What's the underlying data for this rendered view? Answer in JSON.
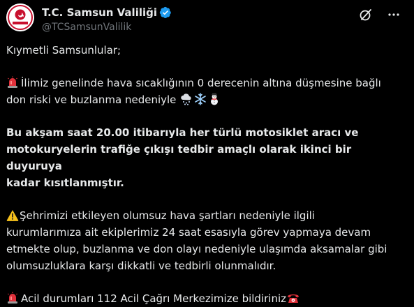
{
  "account": {
    "display_name": "T.C. Samsun Valiliği",
    "handle": "@TCSamsunValilik",
    "verified_color": "#1d9bf0",
    "avatar_icon": "samsun-valilik-seal-icon"
  },
  "header_actions": [
    {
      "name": "grok-icon"
    },
    {
      "name": "more-options-icon"
    }
  ],
  "tweet": {
    "greeting": "Kıymetli Samsunlular;",
    "p1_line1": "İlimiz genelinde hava sıcaklığının 0 derecenin altına düşmesine bağlı",
    "p1_line2": "don riski ve buzlanma nedeniyle",
    "p1_emojis": [
      "cloud-snow-icon",
      "snowflake-icon",
      "snowman-icon"
    ],
    "p2": "Bu akşam saat 20.00 itibarıyla her türlü motosiklet aracı ve motokuryelerin trafiğe çıkışı tedbir amaçlı olarak ikinci bir duyuruya kadar kısıtlanmıştır.",
    "p2_line1": "Bu akşam saat 20.00 itibarıyla her türlü motosiklet aracı ve",
    "p2_line2": "motokuryelerin trafiğe çıkışı tedbir amaçlı olarak ikinci bir duyuruya",
    "p2_line3": "kadar kısıtlanmıştır.",
    "p3_line1": "Şehrimizi etkileyen olumsuz hava şartları nedeniyle ilgili",
    "p3_line2": "kurumlarımıza ait ekiplerimiz 24 saat esasıyla görev yapmaya devam",
    "p3_line3": "etmekte olup, buzlanma ve don olayı nedeniyle ulaşımda aksamalar gibi",
    "p3_line4": "olumsuzluklara karşı dikkatli ve tedbirli olunmalıdır.",
    "p4": "Acil durumları 112 Acil Çağrı Merkezimize bildiriniz"
  },
  "colors": {
    "background": "#000000",
    "text": "#e7e9ea",
    "secondary_text": "#71767b",
    "siren_red": "#e0303a",
    "warning_yellow": "#f5c01b"
  }
}
